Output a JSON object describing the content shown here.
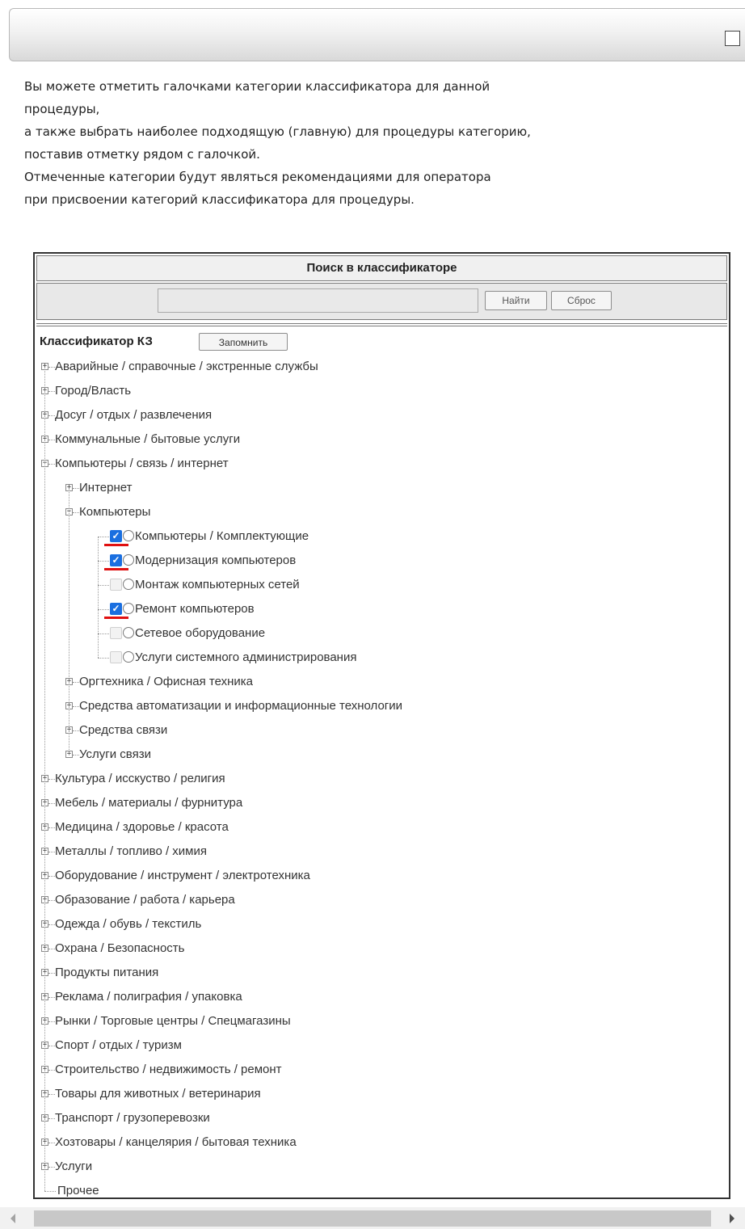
{
  "intro_lines": [
    "Вы можете отметить галочками категории классификатора для данной",
    "процедуры,",
    "а также выбрать наиболее подходящую (главную) для процедуры категорию,",
    "поставив отметку рядом с галочкой.",
    "Отмеченные категории будут являться рекомендациями для оператора",
    "при присвоении категорий классификатора для процедуры."
  ],
  "search": {
    "header": "Поиск в классификаторе",
    "input_value": "",
    "find_label": "Найти",
    "reset_label": "Сброс"
  },
  "tree": {
    "title": "Классификатор КЗ",
    "remember_label": "Запомнить",
    "top_items_before": [
      "Аварийные / справочные / экстренные службы",
      "Город/Власть",
      "Досуг / отдых / развлечения",
      "Коммунальные / бытовые услуги"
    ],
    "expanded_item": "Компьютеры / связь / интернет",
    "sub_internet": "Интернет",
    "sub_computers": "Компьютеры",
    "computer_leaves": [
      {
        "label": "Компьютеры / Комплектующие",
        "checked": true
      },
      {
        "label": "Модернизация компьютеров",
        "checked": true
      },
      {
        "label": "Монтаж компьютерных сетей",
        "checked": false
      },
      {
        "label": "Ремонт компьютеров",
        "checked": true
      },
      {
        "label": "Сетевое оборудование",
        "checked": false
      },
      {
        "label": "Услуги системного администрирования",
        "checked": false
      }
    ],
    "sub_after": [
      "Оргтехника / Офисная техника",
      "Средства автоматизации и информационные технологии",
      "Средства связи",
      "Услуги связи"
    ],
    "top_items_after": [
      "Культура / исскуство / религия",
      "Мебель / материалы / фурнитура",
      "Медицина / здоровье / красота",
      "Металлы / топливо / химия",
      "Оборудование / инструмент / электротехника",
      "Образование / работа / карьера",
      "Одежда / обувь / текстиль",
      "Охрана / Безопасность",
      "Продукты питания",
      "Реклама / полиграфия / упаковка",
      "Рынки / Торговые центры / Спецмагазины",
      "Спорт / отдых / туризм",
      "Строительство / недвижимость / ремонт",
      "Товары для животных / ветеринария",
      "Транспорт / грузоперевозки",
      "Хозтовары / канцелярия / бытовая техника",
      "Услуги"
    ],
    "last_item": "Прочее"
  },
  "colors": {
    "checkbox_checked": "#1a6fe0",
    "highlight_underline": "#e01010"
  }
}
